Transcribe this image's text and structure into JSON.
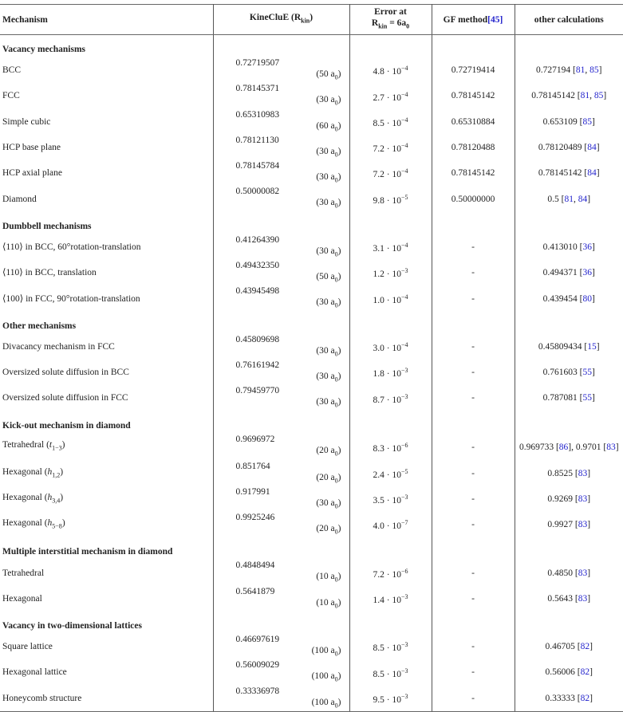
{
  "headers": {
    "mechanism": "Mechanism",
    "kineclue": "KineCluE (R",
    "kineclue_sub": "kin",
    "error_line1": "Error at",
    "error_line2_pre": "R",
    "error_line2_sub": "kin",
    "error_line2_post": " = 6a",
    "error_line2_sub2": "0",
    "gf": "GF method",
    "gf_ref": "[45]",
    "other": "other calculations"
  },
  "sections": [
    {
      "title": "Vacancy mechanisms",
      "rows": [
        {
          "name": "BCC",
          "kinecluE": "0.72719507",
          "rkin": "50",
          "err_m": "4.8",
          "err_e": "−4",
          "gf": "0.72719414",
          "other": "0.727194",
          "refs": [
            "81",
            "85"
          ]
        },
        {
          "name": "FCC",
          "kinecluE": "0.78145371",
          "rkin": "30",
          "err_m": "2.7",
          "err_e": "−4",
          "gf": "0.78145142",
          "other": "0.78145142",
          "refs": [
            "81",
            "85"
          ]
        },
        {
          "name": "Simple cubic",
          "kinecluE": "0.65310983",
          "rkin": "60",
          "err_m": "8.5",
          "err_e": "−4",
          "gf": "0.65310884",
          "other": "0.653109",
          "refs": [
            "85"
          ]
        },
        {
          "name": "HCP base plane",
          "kinecluE": "0.78121130",
          "rkin": "30",
          "err_m": "7.2",
          "err_e": "−4",
          "gf": "0.78120488",
          "other": "0.78120489",
          "refs": [
            "84"
          ]
        },
        {
          "name": "HCP axial plane",
          "kinecluE": "0.78145784",
          "rkin": "30",
          "err_m": "7.2",
          "err_e": "−4",
          "gf": "0.78145142",
          "other": "0.78145142",
          "refs": [
            "84"
          ]
        },
        {
          "name": "Diamond",
          "kinecluE": "0.50000082",
          "rkin": "30",
          "err_m": "9.8",
          "err_e": "−5",
          "gf": "0.50000000",
          "other": "0.5",
          "refs": [
            "81",
            "84"
          ]
        }
      ]
    },
    {
      "title": "Dumbbell mechanisms",
      "rows": [
        {
          "name": "⟨110⟩ in BCC, 60°rotation-translation",
          "kinecluE": "0.41264390",
          "rkin": "30",
          "err_m": "3.1",
          "err_e": "−4",
          "gf": "-",
          "other": "0.413010",
          "refs": [
            "36"
          ]
        },
        {
          "name": "⟨110⟩ in BCC, translation",
          "kinecluE": "0.49432350",
          "rkin": "50",
          "err_m": "1.2",
          "err_e": "−3",
          "gf": "-",
          "other": "0.494371",
          "refs": [
            "36"
          ]
        },
        {
          "name": "⟨100⟩ in FCC, 90°rotation-translation",
          "kinecluE": "0.43945498",
          "rkin": "30",
          "err_m": "1.0",
          "err_e": "−4",
          "gf": "-",
          "other": "0.439454",
          "refs": [
            "80"
          ]
        }
      ]
    },
    {
      "title": "Other mechanisms",
      "rows": [
        {
          "name": "Divacancy mechanism in FCC",
          "kinecluE": "0.45809698",
          "rkin": "30",
          "err_m": "3.0",
          "err_e": "−4",
          "gf": "-",
          "other": "0.45809434",
          "refs": [
            "15"
          ]
        },
        {
          "name": "Oversized solute diffusion in BCC",
          "kinecluE": "0.76161942",
          "rkin": "30",
          "err_m": "1.8",
          "err_e": "−3",
          "gf": "-",
          "other": "0.761603",
          "refs": [
            "55"
          ]
        },
        {
          "name": "Oversized solute diffusion in FCC",
          "kinecluE": "0.79459770",
          "rkin": "30",
          "err_m": "8.7",
          "err_e": "−3",
          "gf": "-",
          "other": "0.787081",
          "refs": [
            "55"
          ]
        }
      ]
    },
    {
      "title": "Kick-out mechanism in diamond",
      "rows": [
        {
          "name": "Tetrahedral",
          "site": "t",
          "site_sub": "1−3",
          "kinecluE": "0.9696972",
          "rkin": "20",
          "err_m": "8.3",
          "err_e": "−6",
          "gf": "-",
          "other": "0.969733",
          "refs": [
            "86"
          ],
          "other2": "0.9701",
          "refs2": [
            "83"
          ]
        },
        {
          "name": "Hexagonal",
          "site": "h",
          "site_sub": "1,2",
          "kinecluE": "0.851764",
          "rkin": "20",
          "err_m": "2.4",
          "err_e": "−5",
          "gf": "-",
          "other": "0.8525",
          "refs": [
            "83"
          ]
        },
        {
          "name": "Hexagonal",
          "site": "h",
          "site_sub": "3,4",
          "kinecluE": "0.917991",
          "rkin": "30",
          "err_m": "3.5",
          "err_e": "−3",
          "gf": "-",
          "other": "0.9269",
          "refs": [
            "83"
          ]
        },
        {
          "name": "Hexagonal",
          "site": "h",
          "site_sub": "5−8",
          "kinecluE": "0.9925246",
          "rkin": "20",
          "err_m": "4.0",
          "err_e": "−7",
          "gf": "-",
          "other": "0.9927",
          "refs": [
            "83"
          ]
        }
      ]
    },
    {
      "title": "Multiple interstitial mechanism in diamond",
      "rows": [
        {
          "name": "Tetrahedral",
          "kinecluE": "0.4848494",
          "rkin": "10",
          "err_m": "7.2",
          "err_e": "−6",
          "gf": "-",
          "other": "0.4850",
          "refs": [
            "83"
          ]
        },
        {
          "name": "Hexagonal",
          "kinecluE": "0.5641879",
          "rkin": "10",
          "err_m": "1.4",
          "err_e": "−3",
          "gf": "-",
          "other": "0.5643",
          "refs": [
            "83"
          ]
        }
      ]
    },
    {
      "title": "Vacancy in two-dimensional lattices",
      "rows": [
        {
          "name": "Square lattice",
          "kinecluE": "0.46697619",
          "rkin": "100",
          "err_m": "8.5",
          "err_e": "−3",
          "gf": "-",
          "other": "0.46705",
          "refs": [
            "82"
          ]
        },
        {
          "name": "Hexagonal lattice",
          "kinecluE": "0.56009029",
          "rkin": "100",
          "err_m": "8.5",
          "err_e": "−3",
          "gf": "-",
          "other": "0.56006",
          "refs": [
            "82"
          ]
        },
        {
          "name": "Honeycomb structure",
          "kinecluE": "0.33336978",
          "rkin": "100",
          "err_m": "9.5",
          "err_e": "−3",
          "gf": "-",
          "other": "0.33333",
          "refs": [
            "82"
          ]
        }
      ]
    }
  ]
}
